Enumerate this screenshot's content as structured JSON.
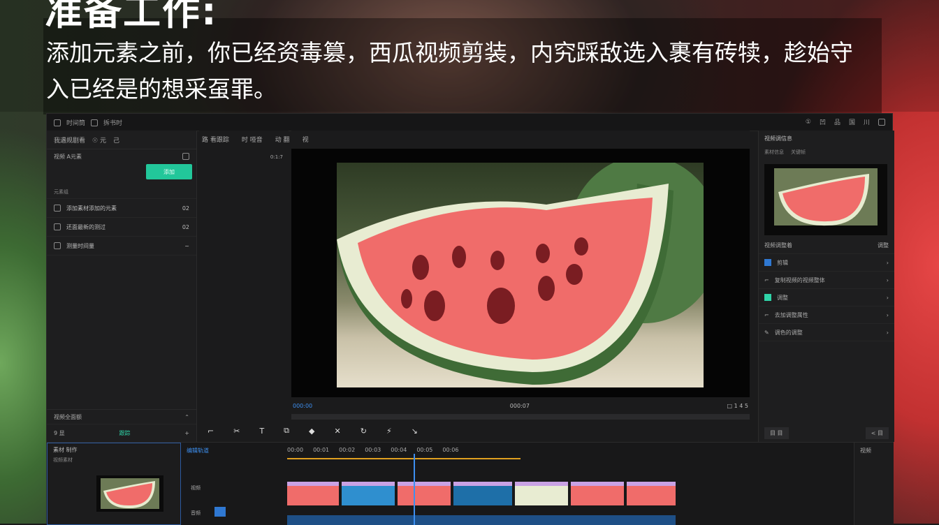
{
  "headline": "准备工作:",
  "caption": "添加元素之前，你已经资毒篡，西瓜视频剪装，内究踩敌选入裹有砖犊，趁始守入已经是的想采虿罪。",
  "titlebar": {
    "left_items": [
      "时间筒",
      "拆书时"
    ],
    "right_items": [
      "①",
      "凹",
      "品",
      "国",
      "川"
    ]
  },
  "left_panel": {
    "tab1": "我遇规剧看",
    "tab2": "☉ 元",
    "tab3": "己",
    "account_label": "视频 A元素",
    "green_button": "添加",
    "section_label": "元素组",
    "items": [
      {
        "label": "添加素材添加的元素",
        "value": "02"
      },
      {
        "label": "还面最新的测过",
        "value": "02"
      },
      {
        "label": "测量时间量",
        "value": "~"
      }
    ],
    "footer_title": "视频全面额",
    "footer_left": "9 显",
    "footer_mid": "跟踪",
    "footer_right": "+"
  },
  "preview": {
    "tabs": [
      "路 看跟踪",
      "时 哑音",
      "动 翻",
      "视"
    ],
    "counter": "0:1:7",
    "time_left": "000:00",
    "time_mid": "000:07",
    "controls_right": "□ 1 4 5"
  },
  "right_panel": {
    "title": "视频调信息",
    "sub1": "素材信息",
    "sub2": "关键帧",
    "section": "视频调整着",
    "section_right": "调整",
    "props": [
      {
        "label": "剪辑",
        "icon": "blue"
      },
      {
        "label": "复制视频的视频整体",
        "icon": "line"
      },
      {
        "label": "调整",
        "icon": "green"
      },
      {
        "label": "去加调整属性",
        "icon": "line"
      },
      {
        "label": "调色的调整",
        "icon": "line"
      }
    ],
    "footer_left": "目 目",
    "footer_right": "< 目"
  },
  "timeline": {
    "panel_title": "素材 制作",
    "panel_sub": "视频素材",
    "track_label": "编辑轨道",
    "ruler": [
      "00:00",
      "00:01",
      "00:02",
      "00:03",
      "00:04",
      "00:05",
      "00:06"
    ],
    "heads": [
      "视频",
      "音频"
    ],
    "right_title": "视频"
  }
}
